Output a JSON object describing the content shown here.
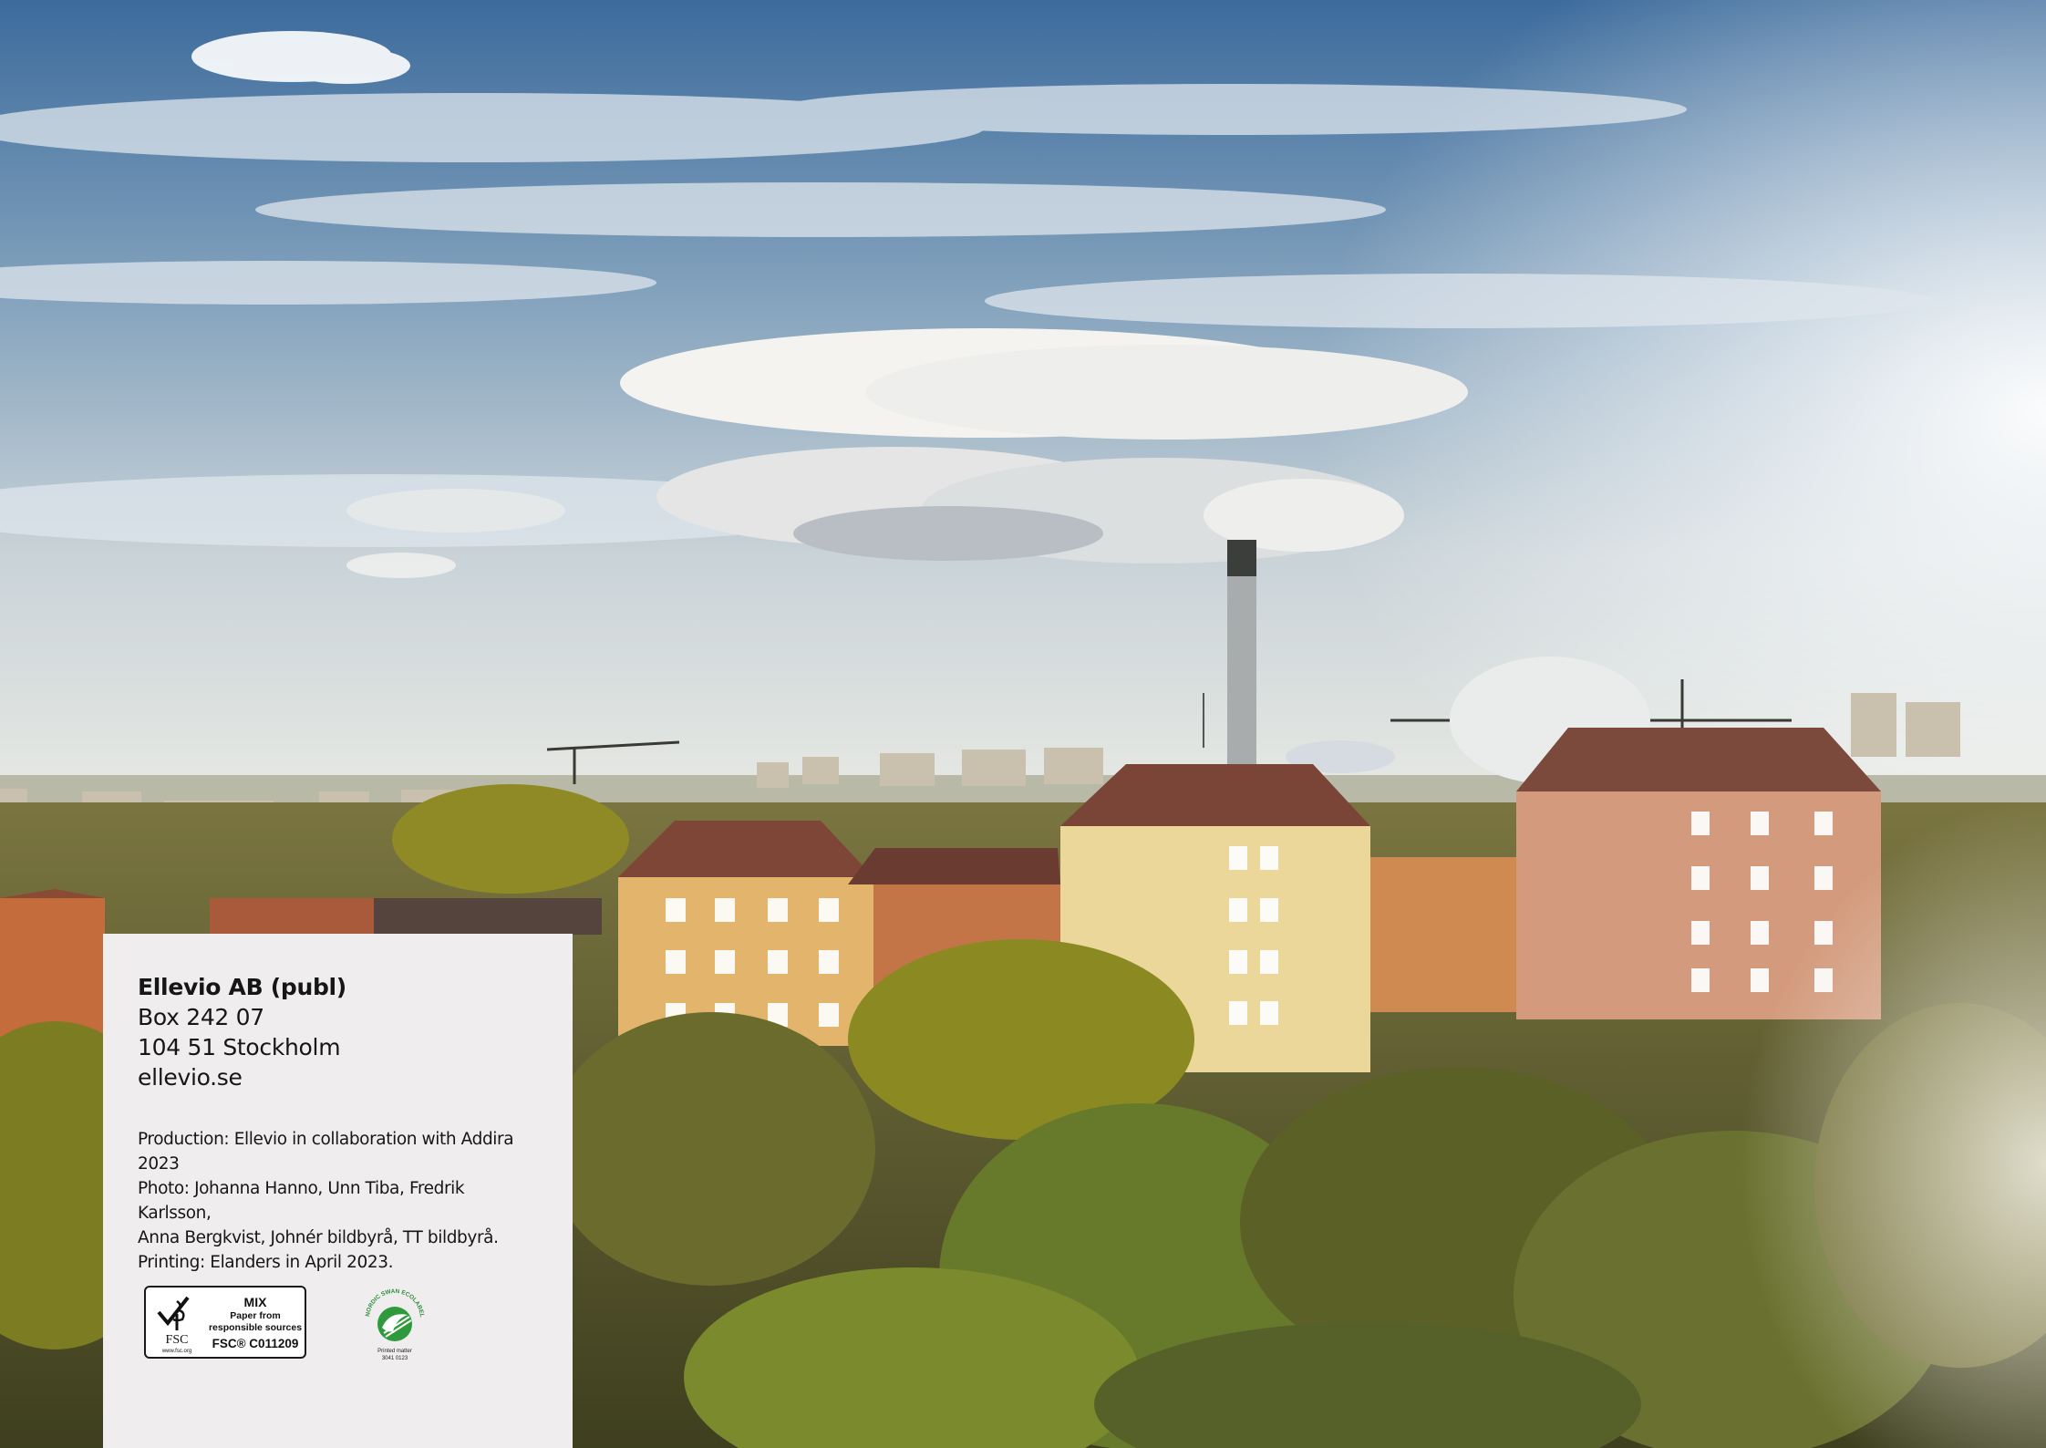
{
  "photo": {
    "description_icon": "stockholm-skyline-photo",
    "colors": {
      "sky_top": "#3f6f9f",
      "sky_haze": "#e8ecec",
      "foliage": "#6b6a2a",
      "building_yellow": "#e3b56c",
      "building_pink": "#d39a7d"
    }
  },
  "address": {
    "company": "Ellevio AB (publ)",
    "box": "Box 242 07",
    "city": "104 51 Stockholm",
    "website": "ellevio.se"
  },
  "credits": {
    "production": "Production: Ellevio in collaboration with Addira 2023",
    "photo_line1": "Photo: Johanna Hanno, Unn Tiba, Fredrik Karlsson,",
    "photo_line2": "Anna Bergkvist, Johnér bildbyrå, TT bildbyrå.",
    "printing": "Printing: Elanders in April 2023."
  },
  "fsc": {
    "icon": "fsc-tree-checkmark-icon",
    "brand": "FSC",
    "url": "www.fsc.org",
    "mix": "MIX",
    "paper_line1": "Paper from",
    "paper_line2": "responsible sources",
    "code": "FSC® C011209"
  },
  "swan": {
    "icon": "nordic-swan-ecolabel-icon",
    "ring_text": "NORDIC SWAN ECOLABEL",
    "label": "Printed matter",
    "number": "3041 0123"
  }
}
